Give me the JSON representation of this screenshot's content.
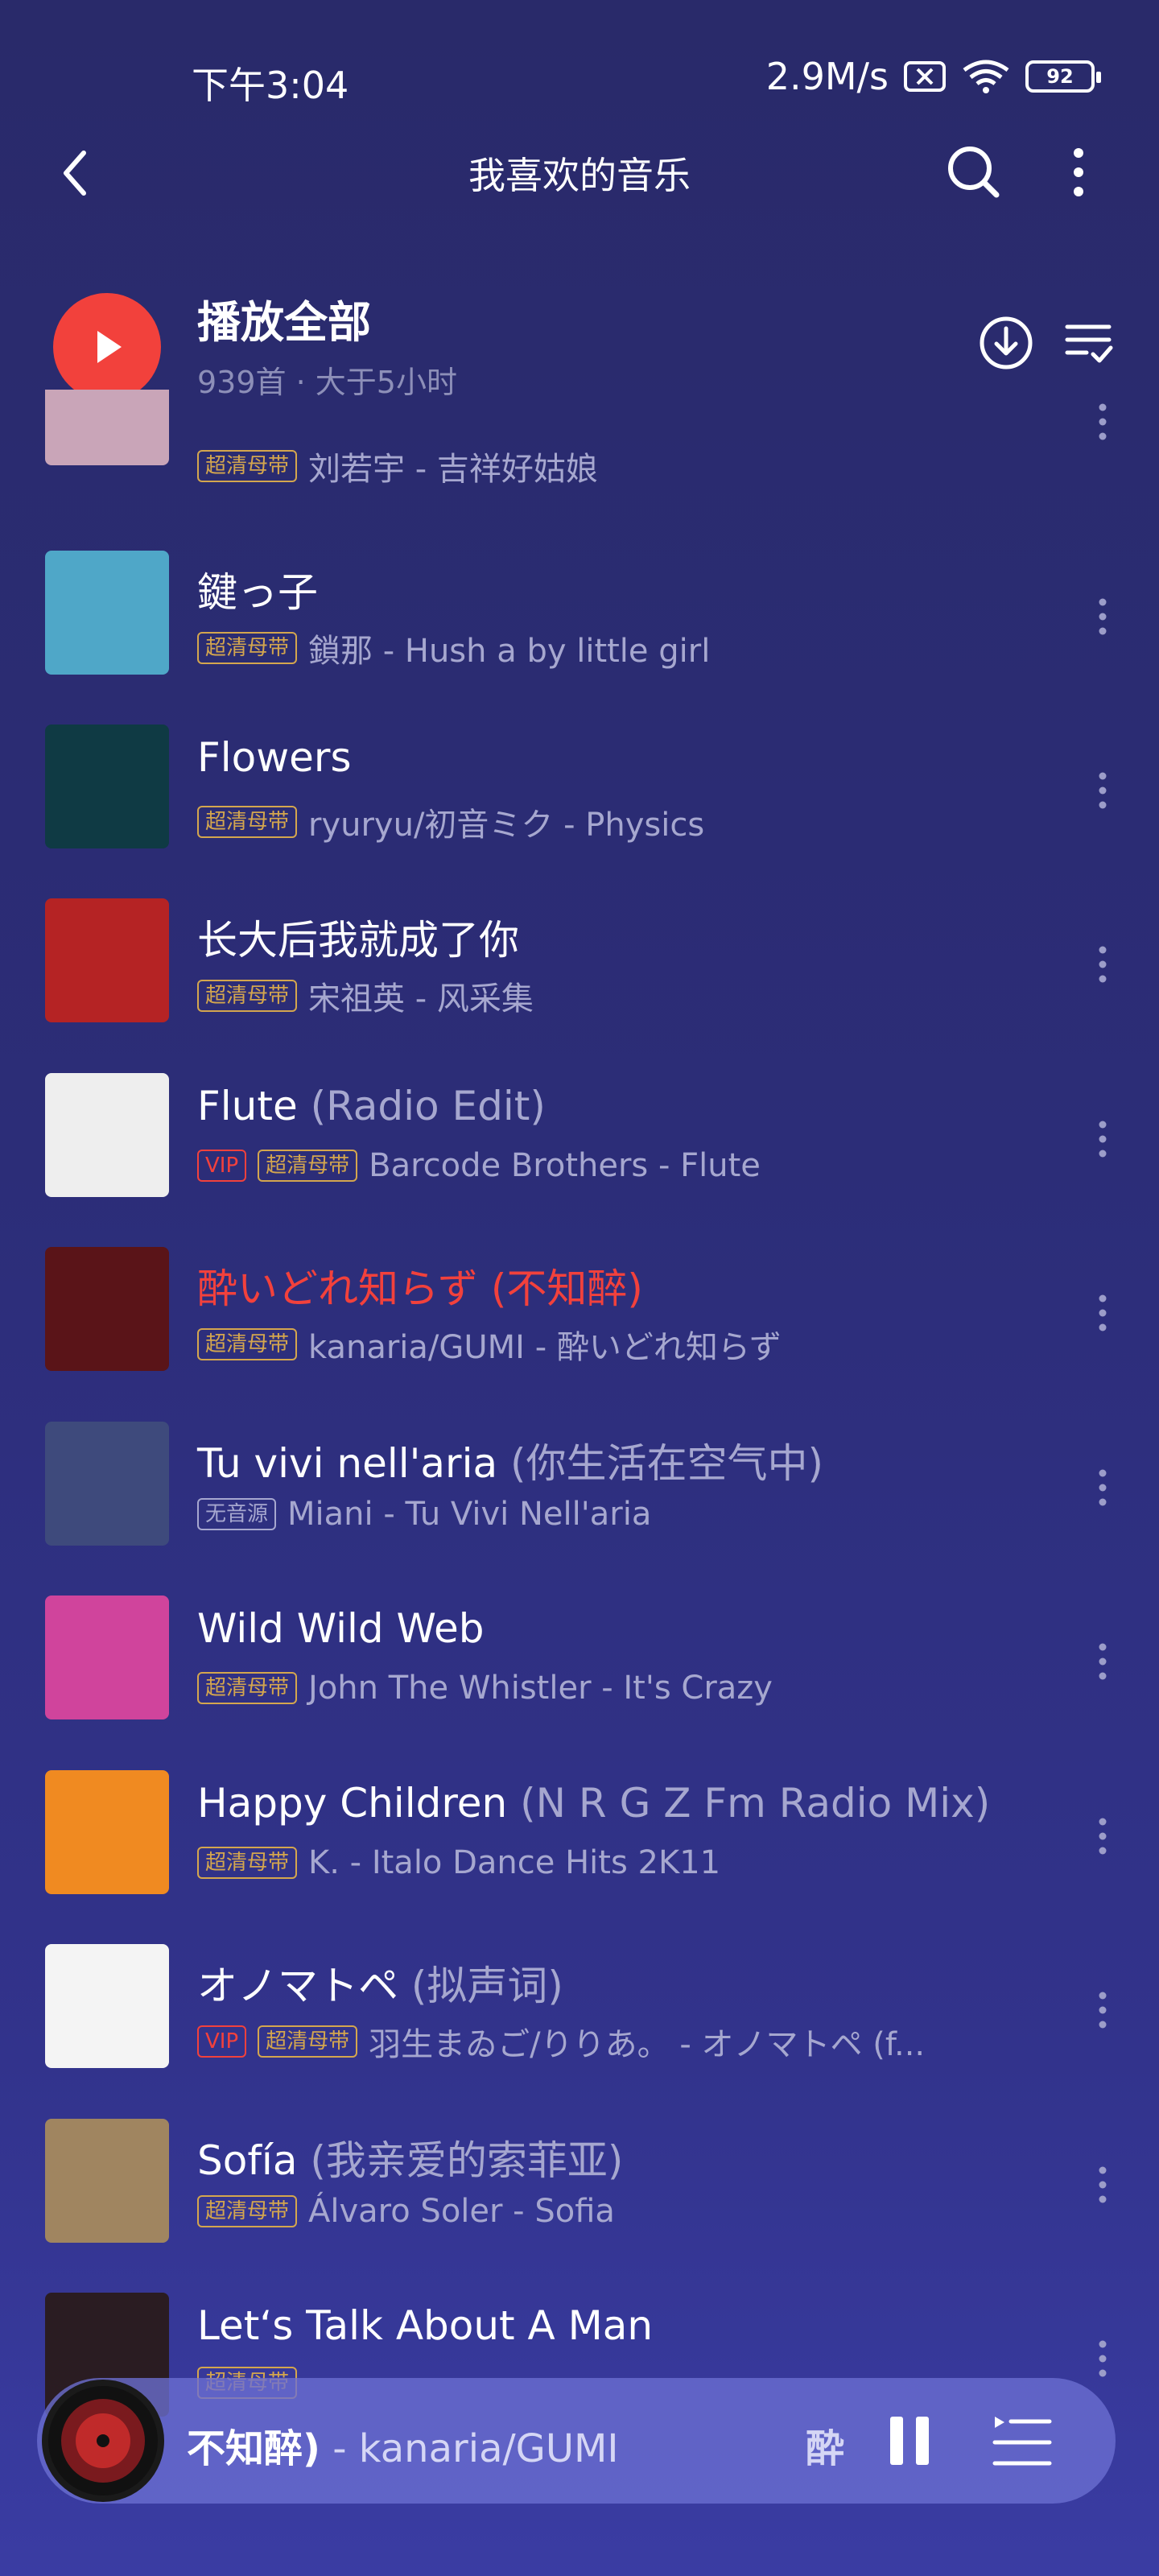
{
  "status": {
    "time": "下午3:04",
    "speed": "2.9M/s",
    "battery": "92"
  },
  "nav": {
    "title": "我喜欢的音乐"
  },
  "play_all": {
    "title": "播放全部",
    "subtitle": "939首 · 大于5小时"
  },
  "songs": [
    {
      "title": "",
      "alias": "",
      "badges": [
        "超清母带"
      ],
      "artist": "刘若宇 - 吉祥好姑娘",
      "playing": false,
      "cover": "#c9a5b8"
    },
    {
      "title": "鍵っ子",
      "alias": "",
      "badges": [
        "超清母带"
      ],
      "artist": "鎖那 - Hush a by little girl",
      "playing": false,
      "cover": "#4fa7c8"
    },
    {
      "title": "Flowers",
      "alias": "",
      "badges": [
        "超清母带"
      ],
      "artist": "ryuryu/初音ミク - Physics",
      "playing": false,
      "cover": "#0f3a44"
    },
    {
      "title": "长大后我就成了你",
      "alias": "",
      "badges": [
        "超清母带"
      ],
      "artist": "宋祖英 - 风采集",
      "playing": false,
      "cover": "#b52324"
    },
    {
      "title": "Flute",
      "alias": " (Radio Edit)",
      "badges": [
        "VIP",
        "超清母带"
      ],
      "artist": "Barcode Brothers - Flute",
      "playing": false,
      "cover": "#eeeeee"
    },
    {
      "title": "酔いどれ知らず",
      "alias": " (不知醉)",
      "badges": [
        "超清母带"
      ],
      "artist": "kanaria/GUMI - 酔いどれ知らず",
      "playing": true,
      "cover": "#5a1418"
    },
    {
      "title": "Tu vivi nell'aria",
      "alias": " (你生活在空气中)",
      "badges": [
        "无音源"
      ],
      "artist": "Miani - Tu Vivi Nell'aria",
      "playing": false,
      "cover": "#3e4a7c"
    },
    {
      "title": "Wild Wild Web",
      "alias": "",
      "badges": [
        "超清母带"
      ],
      "artist": "John The Whistler - It's Crazy",
      "playing": false,
      "cover": "#d0449c"
    },
    {
      "title": "Happy Children",
      "alias": " (N R G Z Fm Radio Mix)",
      "badges": [
        "超清母带"
      ],
      "artist": "K. - Italo Dance Hits 2K11",
      "playing": false,
      "cover": "#f08a21"
    },
    {
      "title": "オノマトペ",
      "alias": " (拟声词)",
      "badges": [
        "VIP",
        "超清母带"
      ],
      "artist": "羽生まゐご/りりあ。 - オノマトペ (f...",
      "playing": false,
      "cover": "#f4f4f4"
    },
    {
      "title": "Sofía",
      "alias": " (我亲爱的索菲亚)",
      "badges": [
        "超清母带"
      ],
      "artist": "Álvaro Soler - Sofia",
      "playing": false,
      "cover": "#a08560"
    },
    {
      "title": "Let‘s Talk About A Man",
      "alias": "",
      "badges": [
        "超清母带"
      ],
      "artist": "",
      "playing": false,
      "cover": "#2a1c22"
    }
  ],
  "mini_player": {
    "title_fragment": "不知醉)",
    "artist": " - kanaria/GUMI",
    "next_fragment": "酔"
  },
  "colors": {
    "accent_red": "#f2413c",
    "badge_gold": "#d4a64e",
    "muted_text": "#a6a7cf"
  }
}
